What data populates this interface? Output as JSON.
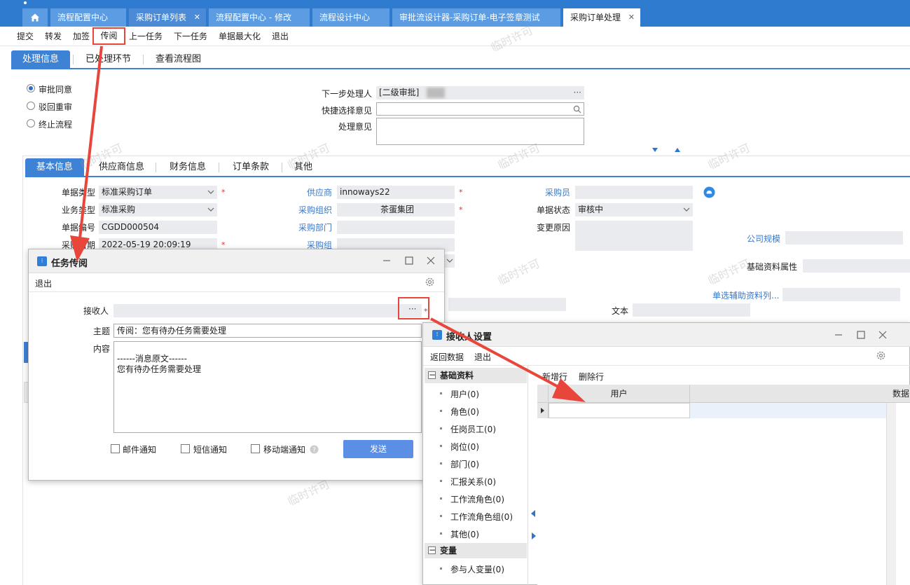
{
  "tabs": [
    {
      "label": ""
    },
    {
      "label": "流程配置中心"
    },
    {
      "label": "采购订单列表",
      "close": "✕"
    },
    {
      "label": "流程配置中心 - 修改"
    },
    {
      "label": "流程设计中心"
    },
    {
      "label": "审批流设计器-采购订单-电子签章测试"
    },
    {
      "label": "采购订单处理",
      "close": "✕"
    }
  ],
  "toolbar": [
    "提交",
    "转发",
    "加签",
    "传阅",
    "上一任务",
    "下一任务",
    "单据最大化",
    "退出"
  ],
  "subtabs": [
    "处理信息",
    "已处理环节",
    "查看流程图"
  ],
  "decision": [
    "审批同意",
    "驳回重审",
    "终止流程"
  ],
  "handling": {
    "next_handler_label": "下一步处理人",
    "next_handler_value": "[二级审批]",
    "ellipsis": "···",
    "quick_opinion_label": "快捷选择意见",
    "opinion_label": "处理意见"
  },
  "bodytabs": [
    "基本信息",
    "供应商信息",
    "财务信息",
    "订单条款",
    "其他"
  ],
  "form": {
    "doc_type_label": "单据类型",
    "doc_type": "标准采购订单",
    "biz_type_label": "业务类型",
    "biz_type": "标准采购",
    "doc_no_label": "单据编号",
    "doc_no": "CGDD000504",
    "date_label": "采购日期",
    "date": "2022-05-19 20:09:19",
    "supplier_label": "供应商",
    "supplier": "innoways22",
    "org_label": "采购组织",
    "org": "茶蛋集团",
    "dept_label": "采购部门",
    "group_label": "采购组",
    "buyer_label": "采购员",
    "status_label": "单据状态",
    "status": "审核中",
    "reason_label": "变更原因",
    "company_label": "公司规模",
    "basic_attr_label": "基础资料属性",
    "single_aux_label": "单选辅助资料列...",
    "text_label": "文本"
  },
  "task_dialog": {
    "title": "任务传阅",
    "exit": "退出",
    "receiver_label": "接收人",
    "ellipsis": "···",
    "subject_label": "主题",
    "subject": "传阅：您有待办任务需要处理",
    "content_label": "内容",
    "content_line1": "------消息原文------",
    "content_line2": "您有待办任务需要处理",
    "email": "邮件通知",
    "sms": "短信通知",
    "mobile": "移动端通知",
    "send": "发送"
  },
  "recv_dialog": {
    "title": "接收人设置",
    "return": "返回数据",
    "exit": "退出",
    "add_row": "新增行",
    "del_row": "删除行",
    "col_user": "用户",
    "col_extra": "数据",
    "group1": "基础资料",
    "items": [
      "用户(0)",
      "角色(0)",
      "任岗员工(0)",
      "岗位(0)",
      "部门(0)",
      "汇报关系(0)",
      "工作流角色(0)",
      "工作流角色组(0)",
      "其他(0)"
    ],
    "group2": "变量",
    "items2": [
      "参与人变量(0)"
    ]
  },
  "watermark": "临时许可",
  "colors": {
    "brand": "#2e7bd0",
    "accent": "#3e82d6",
    "highlight": "#e8463a",
    "send": "#5b8fe6"
  }
}
